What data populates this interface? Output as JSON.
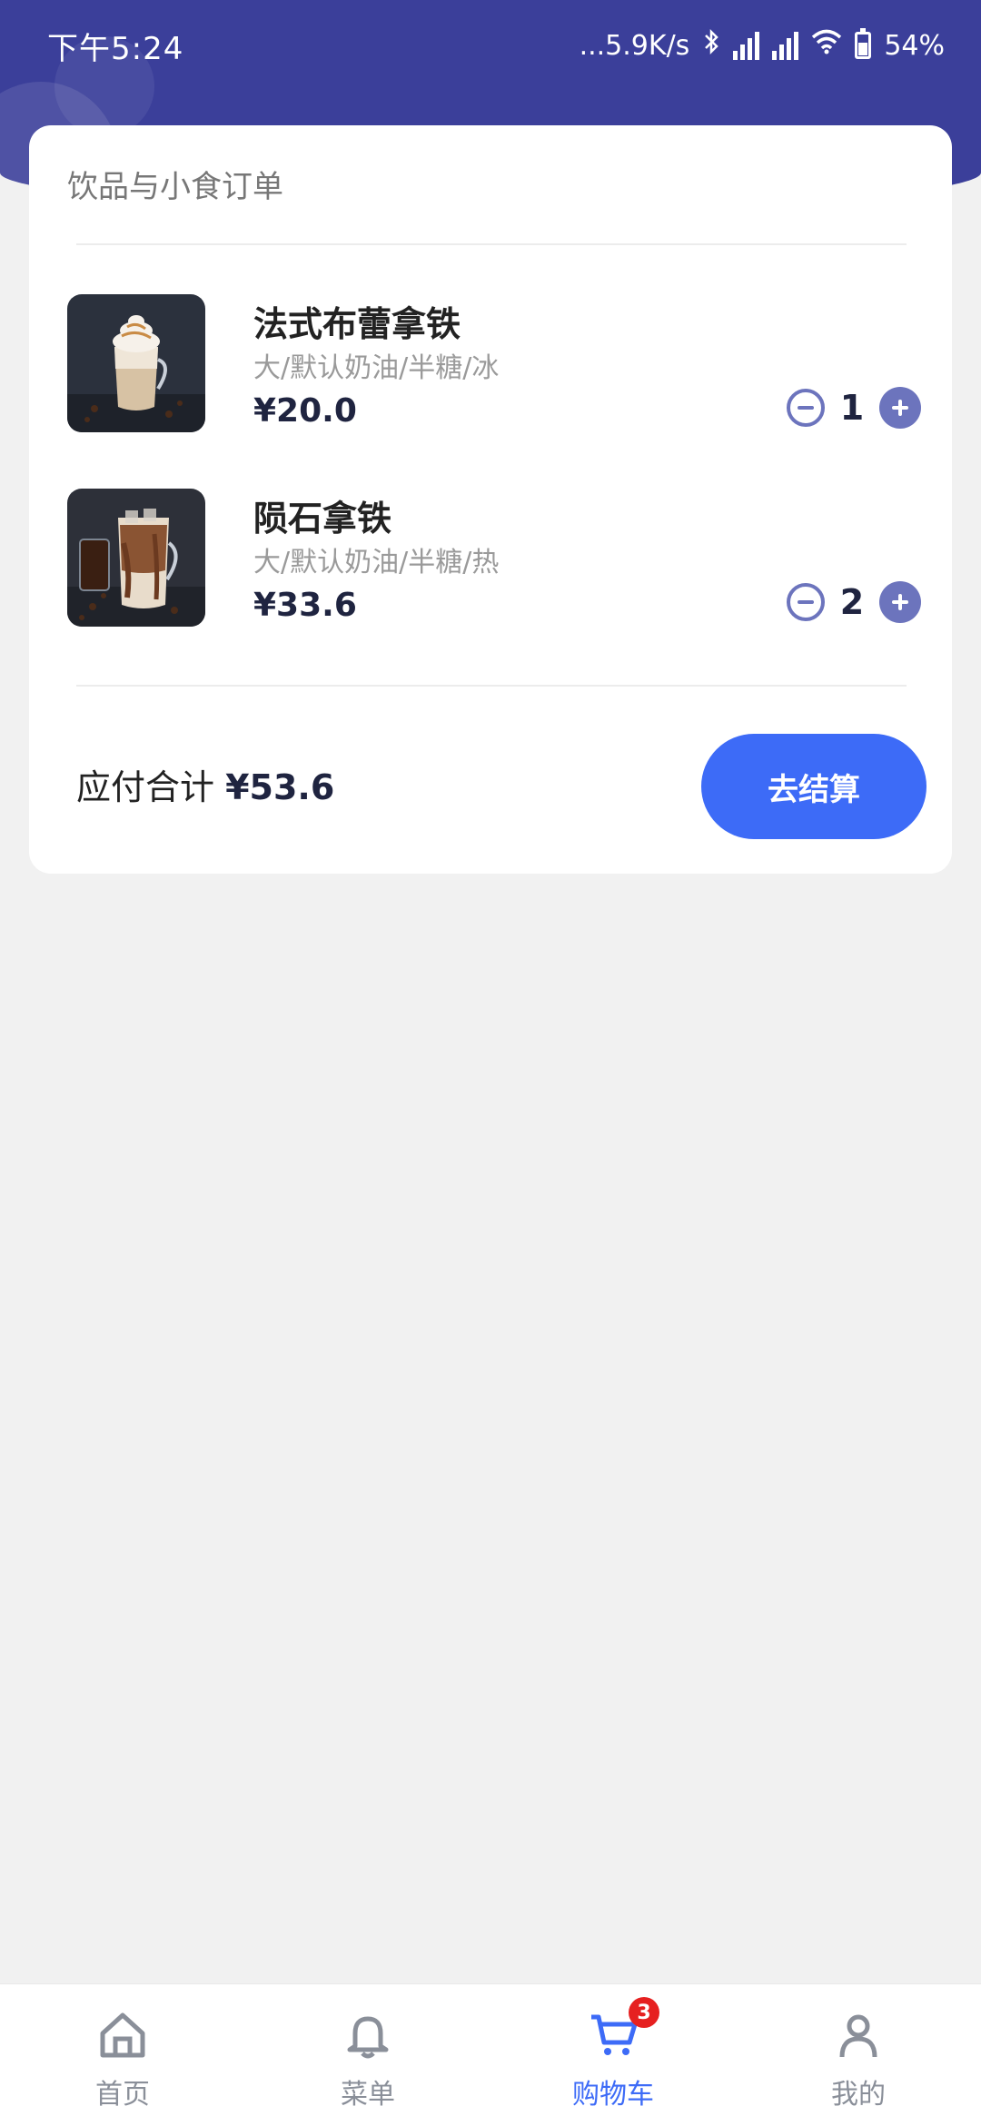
{
  "status_bar": {
    "time": "下午5:24",
    "network_speed": "...5.9K/s",
    "battery": "54%"
  },
  "order": {
    "title": "饮品与小食订单",
    "items": [
      {
        "name": "法式布蕾拿铁",
        "options": "大/默认奶油/半糖/冰",
        "price": "¥20.0",
        "qty": "1"
      },
      {
        "name": "陨石拿铁",
        "options": "大/默认奶油/半糖/热",
        "price": "¥33.6",
        "qty": "2"
      }
    ],
    "total_label": "应付合计",
    "total_amount": "¥53.6",
    "checkout_label": "去结算"
  },
  "tabbar": {
    "home": "首页",
    "menu": "菜单",
    "cart": "购物车",
    "cart_badge": "3",
    "profile": "我的",
    "active_color": "#3d6bf7",
    "inactive_color": "#8a8f99"
  },
  "colors": {
    "header_bg": "#3b3f9a",
    "accent": "#3d6bf7",
    "stepper": "#6c74bd",
    "badge": "#e62020"
  }
}
